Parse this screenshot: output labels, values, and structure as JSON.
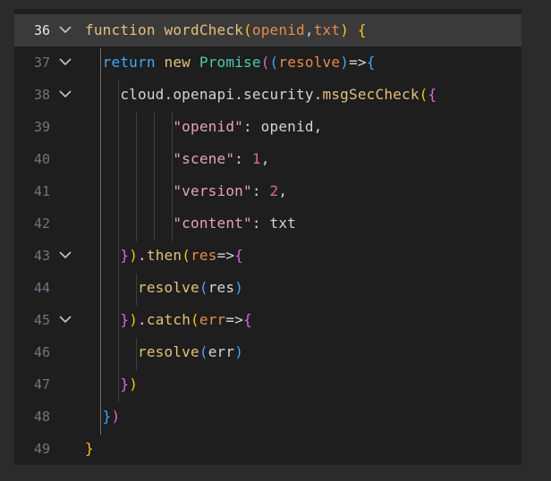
{
  "editor": {
    "current_line": "36",
    "lines": [
      {
        "num": "36",
        "fold": true
      },
      {
        "num": "37",
        "fold": true
      },
      {
        "num": "38",
        "fold": true
      },
      {
        "num": "39",
        "fold": false
      },
      {
        "num": "40",
        "fold": false
      },
      {
        "num": "41",
        "fold": false
      },
      {
        "num": "42",
        "fold": false
      },
      {
        "num": "43",
        "fold": true
      },
      {
        "num": "44",
        "fold": false
      },
      {
        "num": "45",
        "fold": true
      },
      {
        "num": "46",
        "fold": false
      },
      {
        "num": "47",
        "fold": false
      },
      {
        "num": "48",
        "fold": false
      },
      {
        "num": "49",
        "fold": false
      }
    ],
    "tokens": {
      "l36": {
        "kw_function": "function",
        "fn_name": "wordCheck",
        "p_open": "(",
        "param1": "openid",
        "comma": ",",
        "param2": "txt",
        "p_close": ")",
        "brace": " {"
      },
      "l37": {
        "kw_return": "return",
        "kw_new": "new",
        "cls_promise": "Promise",
        "p1": "(",
        "p2": "(",
        "param": "resolve",
        "p3": ")",
        "arrow": "=>",
        "brace": "{"
      },
      "l38": {
        "obj": "cloud.openapi.security.",
        "method": "msgSecCheck",
        "p1": "(",
        "brace": "{"
      },
      "l39": {
        "key": "\"openid\"",
        "colon": ": ",
        "val": "openid",
        "comma": ","
      },
      "l40": {
        "key": "\"scene\"",
        "colon": ": ",
        "val": "1",
        "comma": ","
      },
      "l41": {
        "key": "\"version\"",
        "colon": ": ",
        "val": "2",
        "comma": ","
      },
      "l42": {
        "key": "\"content\"",
        "colon": ": ",
        "val": "txt"
      },
      "l43": {
        "brace": "}",
        "paren": ")",
        "dot": ".",
        "method": "then",
        "p1": "(",
        "param": "res",
        "arrow": "=>",
        "brace2": "{"
      },
      "l44": {
        "method": "resolve",
        "p1": "(",
        "arg": "res",
        "p2": ")"
      },
      "l45": {
        "brace": "}",
        "paren": ")",
        "dot": ".",
        "method": "catch",
        "p1": "(",
        "param": "err",
        "arrow": "=>",
        "brace2": "{"
      },
      "l46": {
        "method": "resolve",
        "p1": "(",
        "arg": "err",
        "p2": ")"
      },
      "l47": {
        "brace": "}",
        "paren": ")"
      },
      "l48": {
        "brace": "}",
        "paren": ")"
      },
      "l49": {
        "brace": "}"
      }
    }
  },
  "colors": {
    "background": "#1e1e1e",
    "outer_background": "#2b2b2b",
    "highlight_line": "#3a3a3a",
    "keyword": "#e5c07b",
    "parameter": "#e78b4b",
    "bracket_level1": "#f4c21e",
    "bracket_level2": "#d070d0",
    "bracket_level3": "#3fa9f5",
    "class": "#4ec9b0",
    "string": "#e8a0c0",
    "number": "#e06c75"
  },
  "icons": {
    "fold": "chevron-down-icon"
  }
}
